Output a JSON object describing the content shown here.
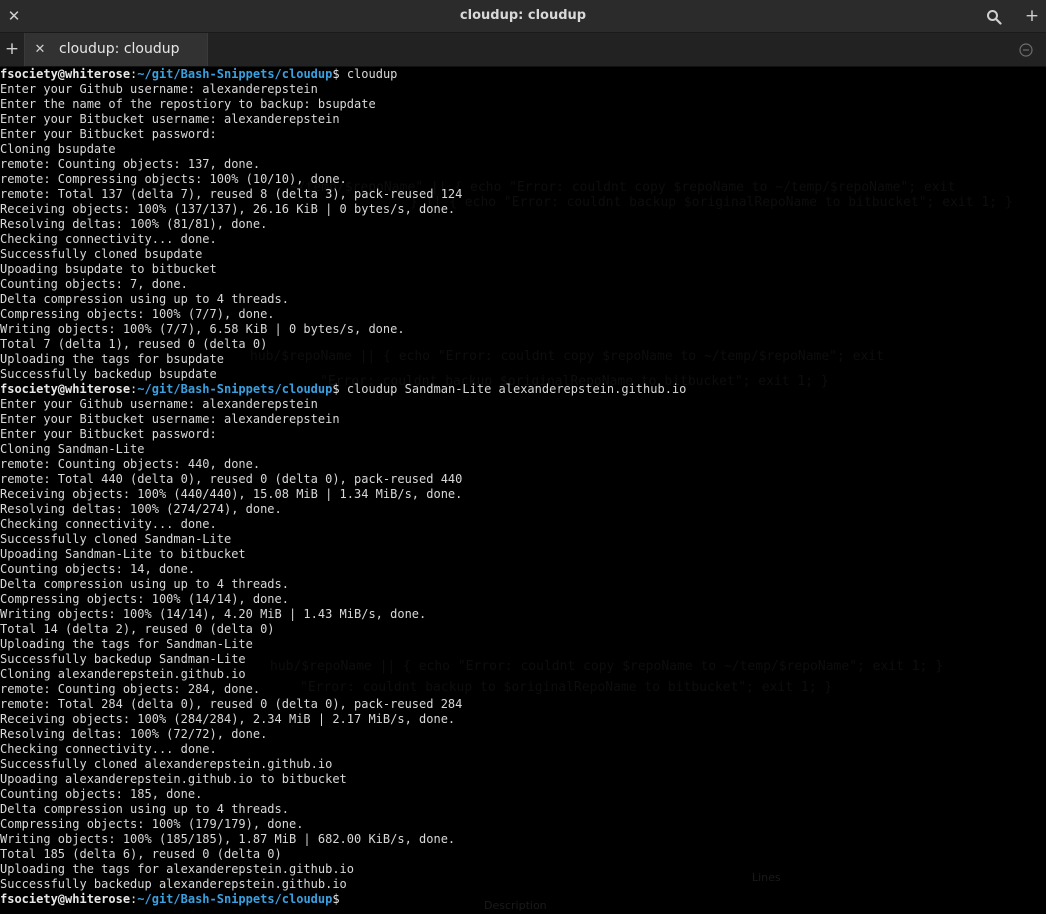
{
  "window": {
    "title": "cloudup: cloudup",
    "close_icon": "close-icon",
    "search_icon": "search-icon",
    "add_icon": "plus-icon"
  },
  "tabs": {
    "new_tab_icon": "plus-icon",
    "items": [
      {
        "label": "cloudup: cloudup",
        "close_icon": "close-icon"
      }
    ],
    "menu_icon": "circle-chevron-icon"
  },
  "prompt": {
    "user": "fsociety@whiterose",
    "sep": ":",
    "path": "~/git/Bash-Snippets/cloudup",
    "symbol": "$"
  },
  "terminal_lines": [
    {
      "type": "prompt",
      "cmd": " cloudup"
    },
    {
      "type": "out",
      "text": "Enter your Github username: alexanderepstein"
    },
    {
      "type": "out",
      "text": "Enter the name of the repostiory to backup: bsupdate"
    },
    {
      "type": "out",
      "text": "Enter your Bitbucket username: alexanderepstein"
    },
    {
      "type": "out",
      "text": "Enter your Bitbucket password:"
    },
    {
      "type": "out",
      "text": "Cloning bsupdate"
    },
    {
      "type": "out",
      "text": "remote: Counting objects: 137, done."
    },
    {
      "type": "out",
      "text": "remote: Compressing objects: 100% (10/10), done."
    },
    {
      "type": "out",
      "text": "remote: Total 137 (delta 7), reused 8 (delta 3), pack-reused 124"
    },
    {
      "type": "out",
      "text": "Receiving objects: 100% (137/137), 26.16 KiB | 0 bytes/s, done."
    },
    {
      "type": "out",
      "text": "Resolving deltas: 100% (81/81), done."
    },
    {
      "type": "out",
      "text": "Checking connectivity... done."
    },
    {
      "type": "out",
      "text": "Successfully cloned bsupdate"
    },
    {
      "type": "out",
      "text": "Upoading bsupdate to bitbucket"
    },
    {
      "type": "out",
      "text": "Counting objects: 7, done."
    },
    {
      "type": "out",
      "text": "Delta compression using up to 4 threads."
    },
    {
      "type": "out",
      "text": "Compressing objects: 100% (7/7), done."
    },
    {
      "type": "out",
      "text": "Writing objects: 100% (7/7), 6.58 KiB | 0 bytes/s, done."
    },
    {
      "type": "out",
      "text": "Total 7 (delta 1), reused 0 (delta 0)"
    },
    {
      "type": "out",
      "text": "Uploading the tags for bsupdate"
    },
    {
      "type": "out",
      "text": "Successfully backedup bsupdate"
    },
    {
      "type": "prompt",
      "cmd": " cloudup Sandman-Lite alexanderepstein.github.io"
    },
    {
      "type": "out",
      "text": "Enter your Github username: alexanderepstein"
    },
    {
      "type": "out",
      "text": "Enter your Bitbucket username: alexanderepstein"
    },
    {
      "type": "out",
      "text": "Enter your Bitbucket password:"
    },
    {
      "type": "out",
      "text": "Cloning Sandman-Lite"
    },
    {
      "type": "out",
      "text": "remote: Counting objects: 440, done."
    },
    {
      "type": "out",
      "text": "remote: Total 440 (delta 0), reused 0 (delta 0), pack-reused 440"
    },
    {
      "type": "out",
      "text": "Receiving objects: 100% (440/440), 15.08 MiB | 1.34 MiB/s, done."
    },
    {
      "type": "out",
      "text": "Resolving deltas: 100% (274/274), done."
    },
    {
      "type": "out",
      "text": "Checking connectivity... done."
    },
    {
      "type": "out",
      "text": "Successfully cloned Sandman-Lite"
    },
    {
      "type": "out",
      "text": "Upoading Sandman-Lite to bitbucket"
    },
    {
      "type": "out",
      "text": "Counting objects: 14, done."
    },
    {
      "type": "out",
      "text": "Delta compression using up to 4 threads."
    },
    {
      "type": "out",
      "text": "Compressing objects: 100% (14/14), done."
    },
    {
      "type": "out",
      "text": "Writing objects: 100% (14/14), 4.20 MiB | 1.43 MiB/s, done."
    },
    {
      "type": "out",
      "text": "Total 14 (delta 2), reused 0 (delta 0)"
    },
    {
      "type": "out",
      "text": "Uploading the tags for Sandman-Lite"
    },
    {
      "type": "out",
      "text": "Successfully backedup Sandman-Lite"
    },
    {
      "type": "out",
      "text": "Cloning alexanderepstein.github.io"
    },
    {
      "type": "out",
      "text": "remote: Counting objects: 284, done."
    },
    {
      "type": "out",
      "text": "remote: Total 284 (delta 0), reused 0 (delta 0), pack-reused 284"
    },
    {
      "type": "out",
      "text": "Receiving objects: 100% (284/284), 2.34 MiB | 2.17 MiB/s, done."
    },
    {
      "type": "out",
      "text": "Resolving deltas: 100% (72/72), done."
    },
    {
      "type": "out",
      "text": "Checking connectivity... done."
    },
    {
      "type": "out",
      "text": "Successfully cloned alexanderepstein.github.io"
    },
    {
      "type": "out",
      "text": "Upoading alexanderepstein.github.io to bitbucket"
    },
    {
      "type": "out",
      "text": "Counting objects: 185, done."
    },
    {
      "type": "out",
      "text": "Delta compression using up to 4 threads."
    },
    {
      "type": "out",
      "text": "Compressing objects: 100% (179/179), done."
    },
    {
      "type": "out",
      "text": "Writing objects: 100% (185/185), 1.87 MiB | 682.00 KiB/s, done."
    },
    {
      "type": "out",
      "text": "Total 185 (delta 6), reused 0 (delta 0)"
    },
    {
      "type": "out",
      "text": "Uploading the tags for alexanderepstein.github.io"
    },
    {
      "type": "out",
      "text": "Successfully backedup alexanderepstein.github.io"
    },
    {
      "type": "prompt",
      "cmd": ""
    }
  ],
  "ghost_text": [
    "~/temp/$repoName\" || { echo \"Error: couldnt copy $repoName to ~/temp/$repoName\"; exit",
    "} || { echo \"Error: couldnt backup $originalRepoName to bitbucket\"; exit 1; }",
    "hub/$repoName || { echo \"Error: couldnt copy $repoName to ~/temp/$repoName\"; exit",
    "\"Error: couldnt backup $originalRepoName to bitbucket\"; exit 1; }",
    "hub/$repoName || { echo \"Error: couldnt copy $repoName to ~/temp/$repoName\"; exit 1; }",
    "\"Error: couldnt backup to $originalRepoName to bitbucket\"; exit 1; }"
  ],
  "ghost_ui": {
    "lines_label": "Lines",
    "description_label": "Description"
  },
  "colors": {
    "prompt_path": "#3aa0e0",
    "prompt_user": "#e8e8e8",
    "text": "#d8d8d8",
    "background": "#000000",
    "header": "#2b2b2b"
  }
}
